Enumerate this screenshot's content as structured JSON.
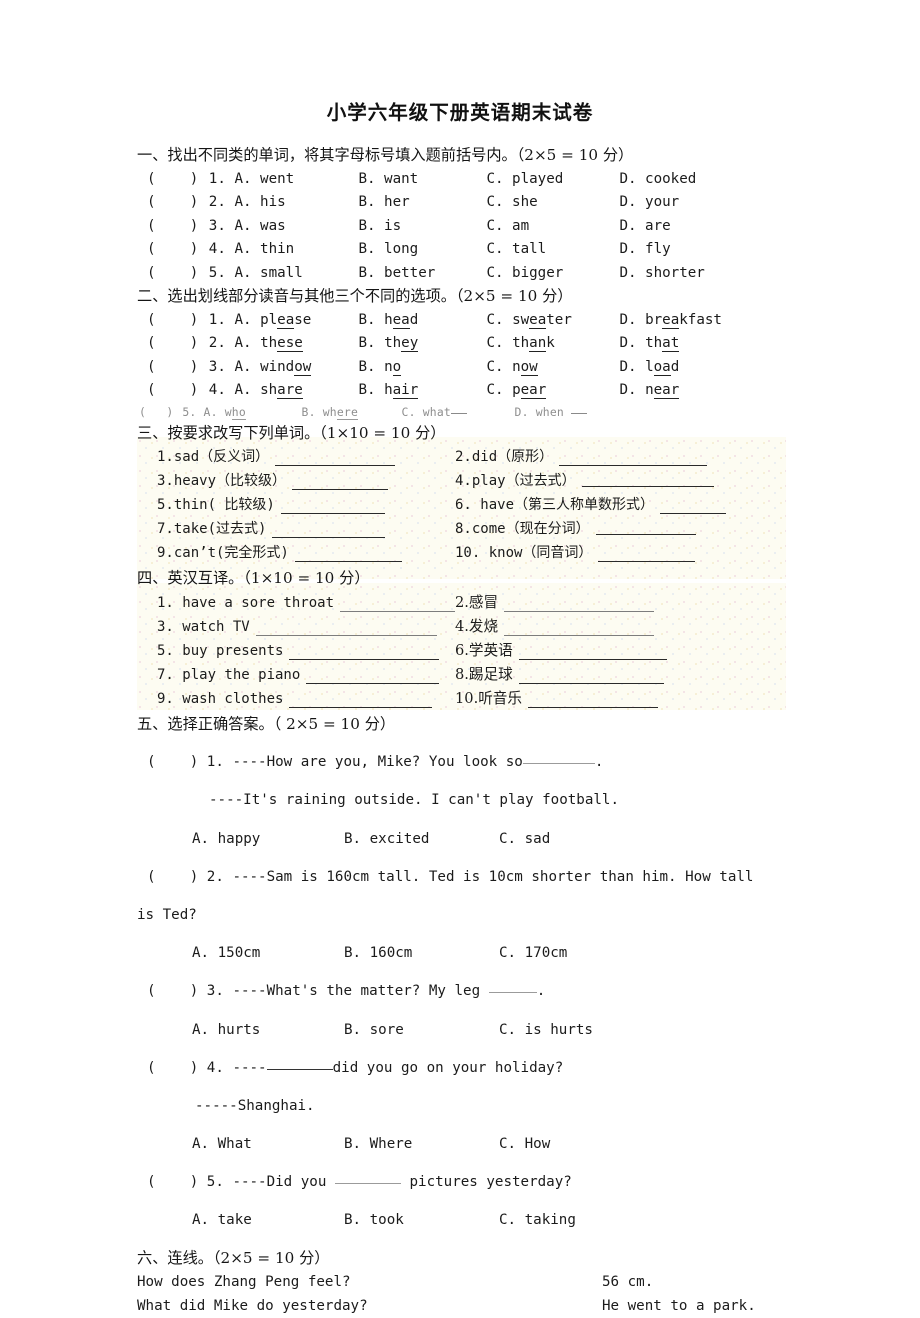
{
  "document": {
    "title": "小学六年级下册英语期末试卷"
  },
  "section1": {
    "heading": "一、找出不同类的单词，将其字母标号填入题前括号内。（2×5 = 10 分）",
    "items": [
      {
        "num": "1.",
        "a": "A. went",
        "b": "B. want",
        "c": "C. played",
        "d": "D. cooked"
      },
      {
        "num": "2.",
        "a": "A. his",
        "b": "B. her",
        "c": "C. she",
        "d": "D. your"
      },
      {
        "num": "3.",
        "a": "A. was",
        "b": "B. is",
        "c": "C. am",
        "d": "D. are"
      },
      {
        "num": "4.",
        "a": "A. thin",
        "b": "B. long",
        "c": "C. tall",
        "d": "D. fly"
      },
      {
        "num": "5.",
        "a": "A. small",
        "b": "B. better",
        "c": "C. bigger",
        "d": "D. shorter"
      }
    ]
  },
  "section2": {
    "heading": "二、选出划线部分读音与其他三个不同的选项。（2×5 = 10 分）",
    "items": [
      {
        "num": "1.",
        "a": {
          "label": "A. ",
          "pre": "pl",
          "mark": "ea",
          "post": "se"
        },
        "b": {
          "label": "B. ",
          "pre": "h",
          "mark": "ea",
          "post": "d"
        },
        "c": {
          "label": "C. ",
          "pre": "sw",
          "mark": "ea",
          "post": "ter"
        },
        "d": {
          "label": "D. ",
          "pre": "br",
          "mark": "ea",
          "post": "kfast"
        }
      },
      {
        "num": "2.",
        "a": {
          "label": "A. ",
          "pre": "th",
          "mark": "ese",
          "post": ""
        },
        "b": {
          "label": "B. ",
          "pre": "th",
          "mark": "ey",
          "post": ""
        },
        "c": {
          "label": "C. ",
          "pre": "th",
          "mark": "an",
          "post": "k"
        },
        "d": {
          "label": "D. ",
          "pre": "th",
          "mark": "at",
          "post": ""
        }
      },
      {
        "num": "3.",
        "a": {
          "label": "A. ",
          "pre": "wind",
          "mark": "ow",
          "post": ""
        },
        "b": {
          "label": "B. ",
          "pre": "n",
          "mark": "o",
          "post": ""
        },
        "c": {
          "label": "C. ",
          "pre": "n",
          "mark": "ow",
          "post": ""
        },
        "d": {
          "label": "D. ",
          "pre": "l",
          "mark": "oa",
          "post": "d"
        }
      },
      {
        "num": "4.",
        "a": {
          "label": "A. ",
          "pre": "sh",
          "mark": "are",
          "post": ""
        },
        "b": {
          "label": "B. ",
          "pre": "h",
          "mark": "air",
          "post": ""
        },
        "c": {
          "label": "C. ",
          "pre": "p",
          "mark": "ear",
          "post": ""
        },
        "d": {
          "label": "D. ",
          "pre": "n",
          "mark": "ear",
          "post": ""
        }
      }
    ],
    "item5": {
      "num": "5.",
      "a": {
        "label": "A. ",
        "pre": "w",
        "mark": "ho",
        "post": ""
      },
      "b": {
        "label": "B. ",
        "pre": "wh",
        "mark": "ere",
        "post": ""
      },
      "c": {
        "label": "C. ",
        "pre": "what",
        "mark": "",
        "post": ""
      },
      "d": {
        "label": "D. ",
        "pre": "when",
        "mark": "",
        "post": ""
      }
    }
  },
  "section3": {
    "heading": "三、按要求改写下列单词。（1×10 = 10 分）",
    "items": [
      {
        "left": "1.sad（反义词）",
        "right": "2.did（原形）"
      },
      {
        "left": "3.heavy（比较级）",
        "right": "4.play（过去式）"
      },
      {
        "left": "5.thin( 比较级)",
        "right": "6. have（第三人称单数形式）"
      },
      {
        "left": "7.take(过去式)",
        "right": "8.come（现在分词）"
      },
      {
        "left": "9.can’t(完全形式)",
        "right": "10. know（同音词）"
      }
    ]
  },
  "section4": {
    "heading": "四、英汉互译。（1×10 = 10 分）",
    "items": [
      {
        "left": "1. have a sore throat",
        "right": "2.感冒"
      },
      {
        "left": "3. watch TV",
        "right": "4.发烧"
      },
      {
        "left": "5. buy presents",
        "right": "6.学英语"
      },
      {
        "left": "7. play the piano",
        "right": "8.踢足球"
      },
      {
        "left": "9. wash clothes",
        "right": "10.听音乐"
      }
    ]
  },
  "section5": {
    "heading": "五、选择正确答案。（ 2×5 = 10 分）",
    "items": [
      {
        "num": "1.",
        "line1_before": "----How are you, Mike? You look so",
        "line1_after": ".",
        "line2": "----It's raining outside. I can't play football.",
        "optA": "A. happy",
        "optB": "B. excited",
        "optC": "C. sad"
      },
      {
        "num": "2.",
        "line1_before": "----Sam is 160cm tall. Ted is 10cm shorter than him. How tall",
        "line1_after": "is Ted?",
        "line2": "",
        "optA": "A. 150cm",
        "optB": "B. 160cm",
        "optC": "C. 170cm"
      },
      {
        "num": "3.",
        "line1_before": "----What's the matter?   My leg",
        "line1_after": ".",
        "line2": "",
        "optA": "A. hurts",
        "optB": "B. sore",
        "optC": "C. is hurts"
      },
      {
        "num": "4.",
        "line1_before": "----",
        "line1_after": "did you go on your holiday?",
        "line2": "-----Shanghai.",
        "optA": "A. What",
        "optB": "B. Where",
        "optC": "C. How"
      },
      {
        "num": "5.",
        "line1_before": "----Did you",
        "line1_after": "pictures yesterday?",
        "line2": "",
        "optA": "A. take",
        "optB": "B. took",
        "optC": "C. taking"
      }
    ]
  },
  "section6": {
    "heading": "六、连线。（2×5 = 10 分）",
    "pairs": [
      {
        "left": "How does Zhang Peng feel?",
        "right": "56 cm."
      },
      {
        "left": "What did Mike do yesterday?",
        "right": "He went to a park."
      }
    ]
  }
}
